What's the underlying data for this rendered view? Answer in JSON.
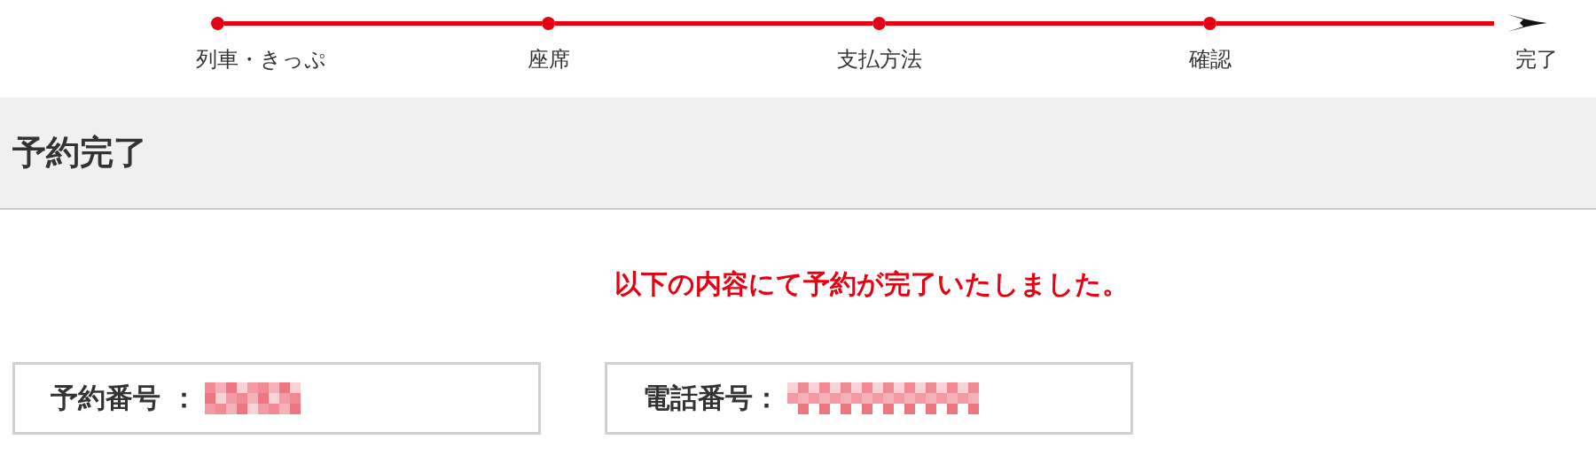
{
  "progress": [
    {
      "kind": "dot",
      "label": "列車・きっぷ"
    },
    {
      "kind": "dot",
      "label": "座席"
    },
    {
      "kind": "dot",
      "label": "支払方法"
    },
    {
      "kind": "dot",
      "label": "確認"
    },
    {
      "kind": "arrow",
      "label": "完了"
    }
  ],
  "page_title": "予約完了",
  "message": "以下の内容にて予約が完了いたしました。",
  "info_boxes": [
    {
      "label": "予約番号 ："
    },
    {
      "label": "電話番号："
    }
  ]
}
